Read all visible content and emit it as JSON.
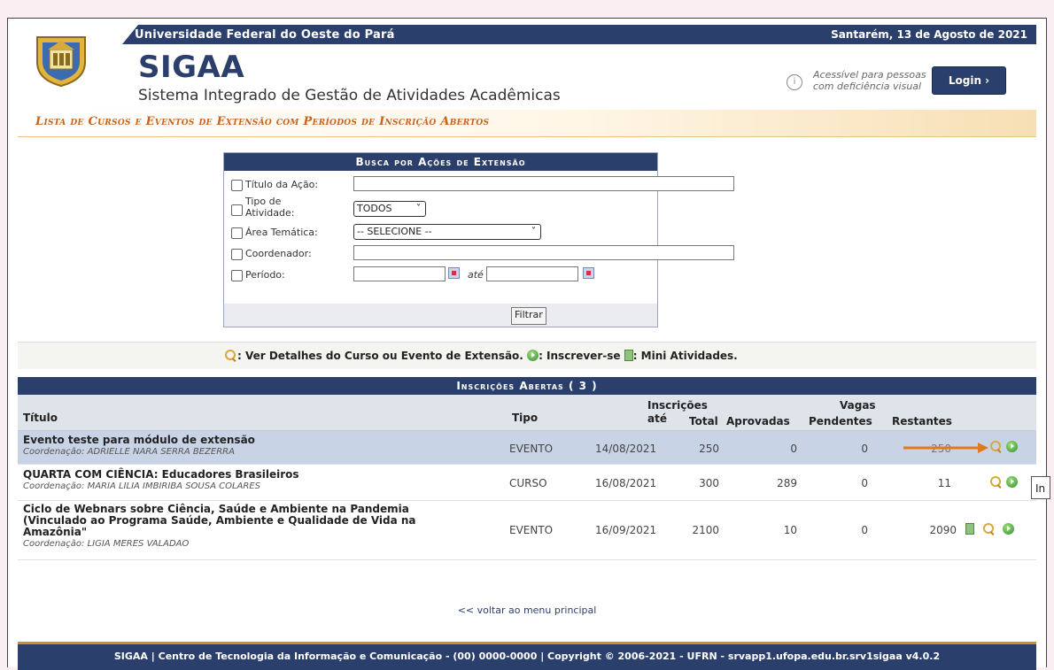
{
  "header": {
    "university": "Universidade Federal do Oeste do Pará",
    "date": "Santarém, 13 de Agosto de 2021",
    "app_name": "SIGAA",
    "app_subtitle": "Sistema Integrado de Gestão de Atividades Acadêmicas",
    "accessibility_line1": "Acessível para pessoas",
    "accessibility_line2": "com deficiência visual",
    "login_label": "Login  ›"
  },
  "page_title": "Lista de Cursos e Eventos de Extensão com Períodos de Inscrição Abertos",
  "search": {
    "caption": "Busca por Ações de Extensão",
    "fields": {
      "titulo_label": "Título da Ação:",
      "tipo_label_1": "Tipo de",
      "tipo_label_2": "Atividade:",
      "tipo_value": "TODOS",
      "area_label": "Área Temática:",
      "area_value": "-- SELECIONE --",
      "coord_label": "Coordenador:",
      "periodo_label": "Período:",
      "ate_label": "até"
    },
    "filter_button": "Filtrar"
  },
  "legend": {
    "details": ": Ver Detalhes do Curso ou Evento de Extensão.",
    "subscribe": ": Inscrever-se",
    "mini": ": Mini Atividades."
  },
  "results": {
    "caption": "Inscrições Abertas ( 3 )",
    "headers": {
      "titulo": "Título",
      "tipo": "Tipo",
      "inscricoes_1": "Inscrições",
      "inscricoes_2": "até",
      "vagas": "Vagas",
      "total": "Total",
      "aprovadas": "Aprovadas",
      "pendentes": "Pendentes",
      "restantes": "Restantes"
    },
    "rows": [
      {
        "title": "Evento teste para módulo de extensão",
        "coord": "Coordenação: ADRIELLE NARA SERRA BEZERRA",
        "tipo": "EVENTO",
        "ate": "14/08/2021",
        "total": "250",
        "aprovadas": "0",
        "pendentes": "0",
        "restantes": "250"
      },
      {
        "title": "QUARTA COM CIÊNCIA: Educadores Brasileiros",
        "coord": "Coordenação: MARIA LILIA IMBIRIBA SOUSA COLARES",
        "tipo": "CURSO",
        "ate": "16/08/2021",
        "total": "300",
        "aprovadas": "289",
        "pendentes": "0",
        "restantes": "11"
      },
      {
        "title_1": "Ciclo de Webnars sobre Ciência, Saúde e Ambiente na Pandemia",
        "title_2": "(Vinculado ao Programa Saúde, Ambiente e Qualidade de Vida na",
        "title_3": "Amazônia\"",
        "coord": "Coordenação: LIGIA MERES VALADAO",
        "tipo": "EVENTO",
        "ate": "16/09/2021",
        "total": "2100",
        "aprovadas": "10",
        "pendentes": "0",
        "restantes": "2090"
      }
    ]
  },
  "back_link": "<< voltar ao menu principal",
  "footer": "SIGAA | Centro de Tecnologia da Informação e Comunicação - (00) 0000-0000 | Copyright © 2006-2021 - UFRN - srvapp1.ufopa.edu.br.srv1sigaa v4.0.2",
  "tooltip": "In",
  "colors": {
    "navy": "#2b3f6c",
    "title_orange": "#c6631d",
    "highlight_row": "#c9d3e6",
    "arrow": "#e07a20"
  }
}
